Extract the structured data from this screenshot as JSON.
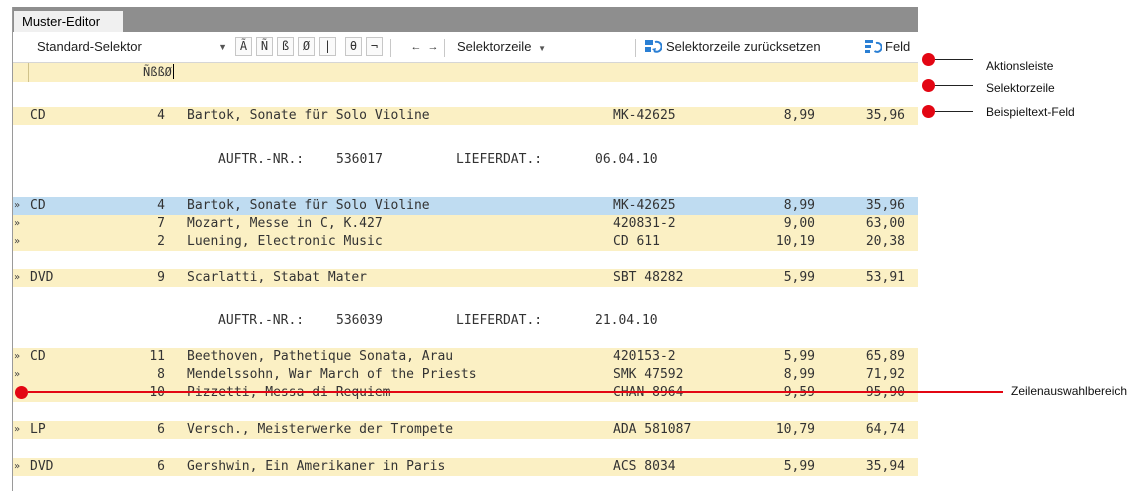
{
  "tab": {
    "label": "Muster-Editor"
  },
  "toolbar": {
    "selector_dropdown": "Standard-Selektor",
    "char_buttons": [
      "Ã",
      "Ñ",
      "ß",
      "Ø",
      "|",
      "θ",
      "¬"
    ],
    "nav_left": "←",
    "nav_right": "→",
    "selector_row_menu": "Selektorzeile",
    "reset_label": "Selektorzeile zurücksetzen",
    "field_label": "Feld"
  },
  "selector_row": {
    "value": "ÑßßØ"
  },
  "sample_row": {
    "type": "CD",
    "qty": "4",
    "desc": "Bartok, Sonate für Solo Violine",
    "number": "MK-42625",
    "price": "8,99",
    "sum": "35,96"
  },
  "orders": [
    {
      "header": {
        "order_label": "AUFTR.-NR.:",
        "order_no": "536017",
        "date_label": "LIEFERDAT.:",
        "date": "06.04.10"
      },
      "rows": [
        {
          "mark": "»",
          "type": "CD",
          "qty": "4",
          "desc": "Bartok, Sonate für Solo Violine",
          "number": "MK-42625",
          "price": "8,99",
          "sum": "35,96"
        },
        {
          "mark": "»",
          "type": "",
          "qty": "7",
          "desc": "Mozart, Messe in C, K.427",
          "number": "420831-2",
          "price": "9,00",
          "sum": "63,00"
        },
        {
          "mark": "»",
          "type": "",
          "qty": "2",
          "desc": "Luening, Electronic Music",
          "number": "CD 611",
          "price": "10,19",
          "sum": "20,38"
        },
        {
          "mark": "»",
          "type": "DVD",
          "qty": "9",
          "desc": "Scarlatti, Stabat Mater",
          "number": "SBT 48282",
          "price": "5,99",
          "sum": "53,91"
        }
      ]
    },
    {
      "header": {
        "order_label": "AUFTR.-NR.:",
        "order_no": "536039",
        "date_label": "LIEFERDAT.:",
        "date": "21.04.10"
      },
      "rows": [
        {
          "mark": "»",
          "type": "CD",
          "qty": "11",
          "desc": "Beethoven, Pathetique Sonata, Arau",
          "number": "420153-2",
          "price": "5,99",
          "sum": "65,89"
        },
        {
          "mark": "»",
          "type": "",
          "qty": "8",
          "desc": "Mendelssohn, War March of the Priests",
          "number": "SMK 47592",
          "price": "8,99",
          "sum": "71,92"
        },
        {
          "mark": "",
          "type": "",
          "qty": "10",
          "desc": "Pizzetti, Messa di Requiem",
          "number": "CHAN 8964",
          "price": "9,59",
          "sum": "95,90"
        },
        {
          "mark": "»",
          "type": "LP",
          "qty": "6",
          "desc": "Versch., Meisterwerke der Trompete",
          "number": "ADA 581087",
          "price": "10,79",
          "sum": "64,74"
        },
        {
          "mark": "»",
          "type": "DVD",
          "qty": "6",
          "desc": "Gershwin, Ein Amerikaner in Paris",
          "number": "ACS 8034",
          "price": "5,99",
          "sum": "35,94"
        }
      ]
    }
  ],
  "annotations": {
    "action_bar": "Aktionsleiste",
    "selector_row": "Selektorzeile",
    "sample_text_field": "Beispieltext-Feld",
    "row_selection_area": "Zeilenauswahlbereich"
  },
  "colors": {
    "highlight": "#fbf0c4",
    "selected": "#bfdcf1",
    "callout_red": "#e30613",
    "tabbar": "#8e8e8e"
  }
}
